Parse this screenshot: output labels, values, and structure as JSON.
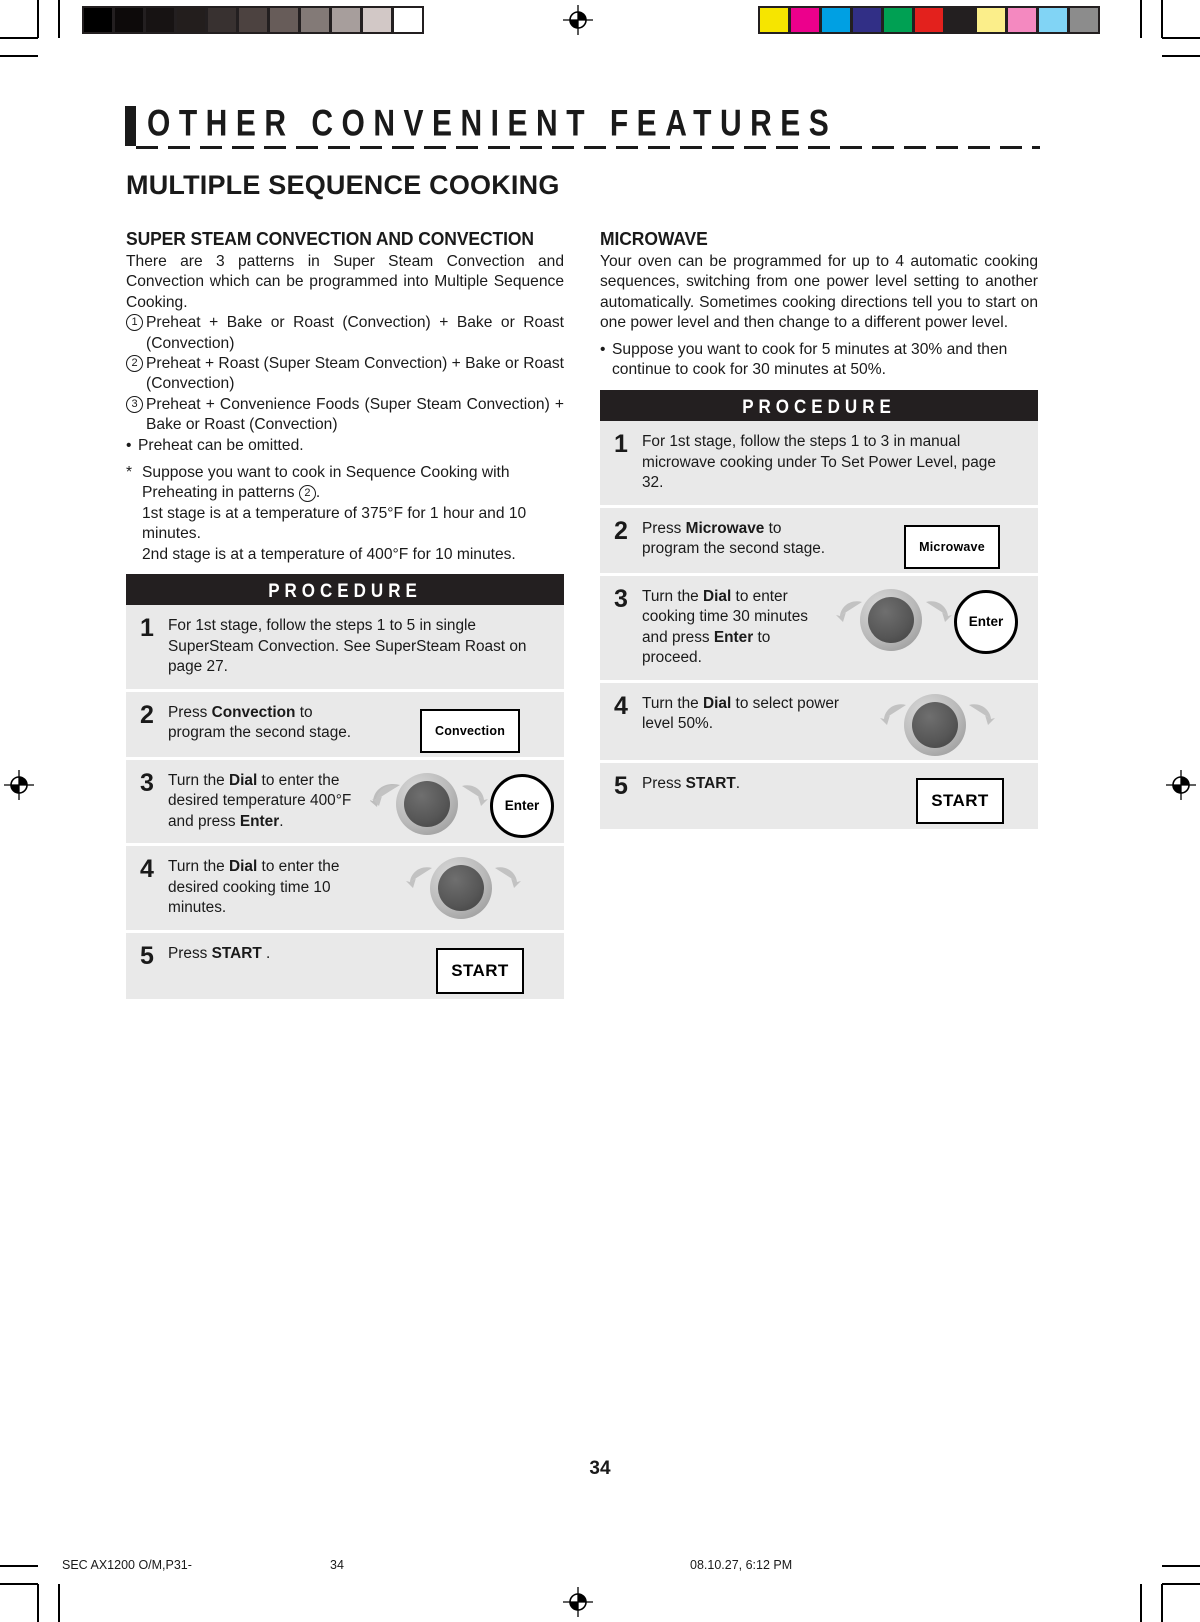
{
  "chapter": {
    "title": "OTHER CONVENIENT FEATURES"
  },
  "section": {
    "title": "MULTIPLE SEQUENCE COOKING"
  },
  "left_column": {
    "heading": "SUPER STEAM CONVECTION AND CONVECTION",
    "intro": "There are 3 patterns in Super Steam Convection and Convection which can be programmed into Multiple Sequence Cooking.",
    "patterns": [
      {
        "num": "1",
        "text": "Preheat + Bake or Roast (Convection) + Bake or Roast (Convection)"
      },
      {
        "num": "2",
        "text": "Preheat + Roast (Super Steam Convection) + Bake or Roast (Convection)"
      },
      {
        "num": "3",
        "text": "Preheat + Convenience Foods (Super Steam Convection) + Bake or Roast (Convection)"
      }
    ],
    "bullet": "Preheat can be omitted.",
    "note": {
      "lead_a": "Suppose you want to cook in Sequence Cooking with Preheating in patterns",
      "lead_circle": "2",
      "lead_b": ".",
      "line2": "1st stage is at a temperature of 375°F for 1 hour and 10 minutes.",
      "line3": "2nd stage is at a temperature of 400°F for 10 minutes."
    },
    "procedure": {
      "header": "PROCEDURE",
      "steps": [
        {
          "num": "1",
          "text_parts": [
            {
              "t": "For 1st stage, follow the steps 1 to 5 in single SuperSteam Convection. See SuperSteam Roast on page 27.",
              "b": false
            }
          ],
          "art": "none"
        },
        {
          "num": "2",
          "text_parts": [
            {
              "t": "Press ",
              "b": false
            },
            {
              "t": "Convection",
              "b": true
            },
            {
              "t": " to program the second stage.",
              "b": false
            }
          ],
          "art": "key",
          "key_label": "Convection"
        },
        {
          "num": "3",
          "text_parts": [
            {
              "t": "Turn the ",
              "b": false
            },
            {
              "t": "Dial",
              "b": true
            },
            {
              "t": " to enter the desired temperature 400°F and press ",
              "b": false
            },
            {
              "t": "Enter",
              "b": true
            },
            {
              "t": ".",
              "b": false
            }
          ],
          "art": "dial-enter",
          "enter_label": "Enter"
        },
        {
          "num": "4",
          "text_parts": [
            {
              "t": "Turn the ",
              "b": false
            },
            {
              "t": "Dial",
              "b": true
            },
            {
              "t": " to enter the desired cooking time 10 minutes.",
              "b": false
            }
          ],
          "art": "dial"
        },
        {
          "num": "5",
          "text_parts": [
            {
              "t": "Press ",
              "b": false
            },
            {
              "t": "START",
              "b": true
            },
            {
              "t": " .",
              "b": false
            }
          ],
          "art": "start",
          "key_label": "START"
        }
      ]
    }
  },
  "right_column": {
    "heading": "MICROWAVE",
    "intro": "Your oven can be programmed for up to 4 automatic cooking sequences, switching from one power level setting to another automatically. Sometimes cooking directions tell you to start on one power level and then change to a different power level.",
    "bullet": "Suppose you want to cook for 5 minutes at 30% and then continue to cook for 30 minutes at 50%.",
    "procedure": {
      "header": "PROCEDURE",
      "steps": [
        {
          "num": "1",
          "text_parts": [
            {
              "t": "For 1st stage, follow the steps 1 to 3 in manual microwave cooking under To Set Power Level, page 32.",
              "b": false
            }
          ],
          "art": "none"
        },
        {
          "num": "2",
          "text_parts": [
            {
              "t": "Press ",
              "b": false
            },
            {
              "t": "Microwave",
              "b": true
            },
            {
              "t": " to program the second stage.",
              "b": false
            }
          ],
          "art": "key",
          "key_label": "Microwave"
        },
        {
          "num": "3",
          "text_parts": [
            {
              "t": "Turn the ",
              "b": false
            },
            {
              "t": "Dial",
              "b": true
            },
            {
              "t": " to enter cooking time 30 minutes and press ",
              "b": false
            },
            {
              "t": "Enter",
              "b": true
            },
            {
              "t": " to proceed.",
              "b": false
            }
          ],
          "art": "dial-enter",
          "enter_label": "Enter"
        },
        {
          "num": "4",
          "text_parts": [
            {
              "t": "Turn the ",
              "b": false
            },
            {
              "t": "Dial",
              "b": true
            },
            {
              "t": " to select power level 50%.",
              "b": false
            }
          ],
          "art": "dial"
        },
        {
          "num": "5",
          "text_parts": [
            {
              "t": "Press ",
              "b": false
            },
            {
              "t": "START",
              "b": true
            },
            {
              "t": ".",
              "b": false
            }
          ],
          "art": "start",
          "key_label": "START"
        }
      ]
    }
  },
  "page_number": "34",
  "footer": {
    "left": "SEC AX1200 O/M,P31-",
    "middle": "34",
    "right": "08.10.27, 6:12 PM"
  },
  "calibration": {
    "gray_strip": [
      "#000000",
      "#0d0a0a",
      "#171313",
      "#231e1d",
      "#383130",
      "#4c4240",
      "#675c59",
      "#837a77",
      "#a79e9c",
      "#d2c8c6",
      "#ffffff"
    ],
    "color_strip": [
      "#f6e500",
      "#ec008c",
      "#00a0e3",
      "#312f86",
      "#00a053",
      "#e3211d",
      "#231f20",
      "#fbee8a",
      "#f489c0",
      "#81d4f5",
      "#8c8c8c"
    ]
  }
}
